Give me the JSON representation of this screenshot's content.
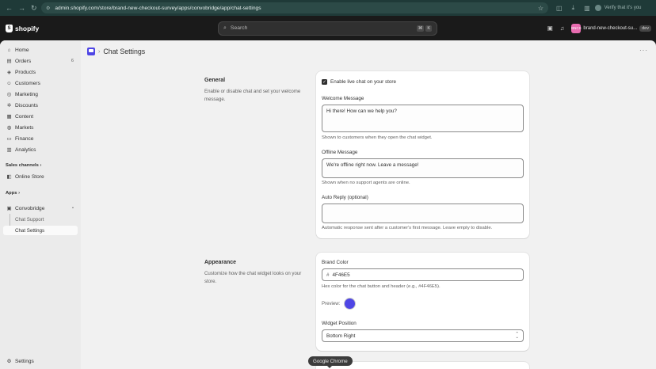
{
  "browser": {
    "url": "admin.shopify.com/store/brand-new-checkout-survey/apps/convobridge/app/chat-settings",
    "profile_label": "Verify that it's you"
  },
  "topbar": {
    "logo_text": "shopify",
    "search_placeholder": "Search",
    "shortcut_keys": [
      "⌘",
      "K"
    ],
    "store_initials": "BNCS",
    "store_name": "brand-new-checkout-su...",
    "dev_badge": "dev"
  },
  "sidebar": {
    "items": [
      {
        "label": "Home",
        "icon": "home-icon"
      },
      {
        "label": "Orders",
        "icon": "orders-icon",
        "count": "6"
      },
      {
        "label": "Products",
        "icon": "products-icon"
      },
      {
        "label": "Customers",
        "icon": "customers-icon"
      },
      {
        "label": "Marketing",
        "icon": "marketing-icon"
      },
      {
        "label": "Discounts",
        "icon": "discounts-icon"
      },
      {
        "label": "Content",
        "icon": "content-icon"
      },
      {
        "label": "Markets",
        "icon": "markets-icon"
      },
      {
        "label": "Finance",
        "icon": "finance-icon"
      },
      {
        "label": "Analytics",
        "icon": "analytics-icon"
      }
    ],
    "sales_channels_label": "Sales channels",
    "online_store_label": "Online Store",
    "apps_label": "Apps",
    "app_name": "Convobridge",
    "app_subitems": [
      "Chat Support",
      "Chat Settings"
    ],
    "settings_label": "Settings"
  },
  "page": {
    "title": "Chat Settings"
  },
  "general": {
    "heading": "General",
    "description": "Enable or disable chat and set your welcome message.",
    "enable_label": "Enable live chat on your store",
    "enable_checked": true,
    "welcome_label": "Welcome Message",
    "welcome_value": "Hi there! How can we help you?",
    "welcome_help": "Shown to customers when they open the chat widget.",
    "offline_label": "Offline Message",
    "offline_value": "We're offline right now. Leave a message!",
    "offline_help": "Shown when no support agents are online.",
    "autoreply_label": "Auto Reply (optional)",
    "autoreply_value": "",
    "autoreply_help": "Automatic response sent after a customer's first message. Leave empty to disable."
  },
  "appearance": {
    "heading": "Appearance",
    "description": "Customize how the chat widget looks on your store.",
    "brand_color_label": "Brand Color",
    "brand_color_prefix": "#",
    "brand_color_value": "4F46E5",
    "brand_color_hex": "#4F46E5",
    "brand_color_help": "Hex color for the chat button and header (e.g., #4F46E5).",
    "preview_label": "Preview:",
    "position_label": "Widget Position",
    "position_value": "Bottom Right"
  },
  "tooltip": "Google Chrome"
}
